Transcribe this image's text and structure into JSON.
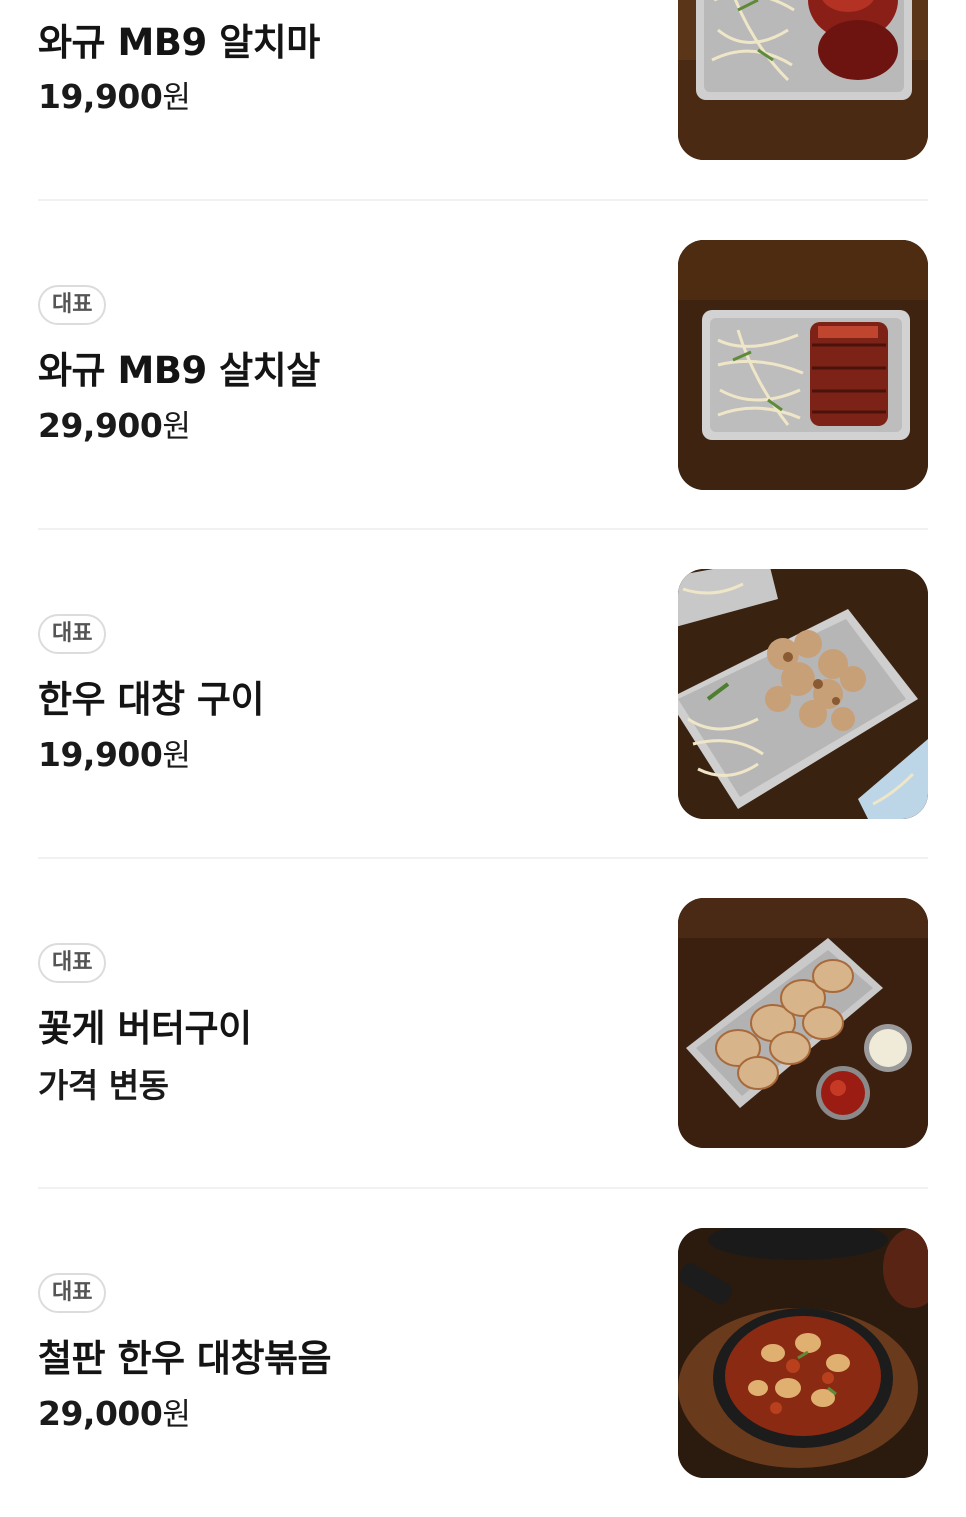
{
  "menu": {
    "items": [
      {
        "badge": "",
        "name": "와규 MB9 알치마",
        "price_number": "19,900",
        "price_unit": "원",
        "image_icon": "steak-sprouts-tray-photo"
      },
      {
        "badge": "대표",
        "name": "와규 MB9 살치살",
        "price_number": "29,900",
        "price_unit": "원",
        "image_icon": "steak-sprouts-tray-photo"
      },
      {
        "badge": "대표",
        "name": "한우 대창 구이",
        "price_number": "19,900",
        "price_unit": "원",
        "image_icon": "grilled-intestine-tray-photo"
      },
      {
        "badge": "대표",
        "name": "꽃게 버터구이",
        "price_number": "가격 변동",
        "price_unit": "",
        "image_icon": "butter-crab-tray-photo"
      },
      {
        "badge": "대표",
        "name": "철판 한우 대창볶음",
        "price_number": "29,000",
        "price_unit": "원",
        "image_icon": "iron-skillet-stirfry-photo"
      }
    ]
  },
  "colors": {
    "divider": "#f1f1f1",
    "badge_border": "#dcdcdc",
    "text_primary": "#141414"
  }
}
